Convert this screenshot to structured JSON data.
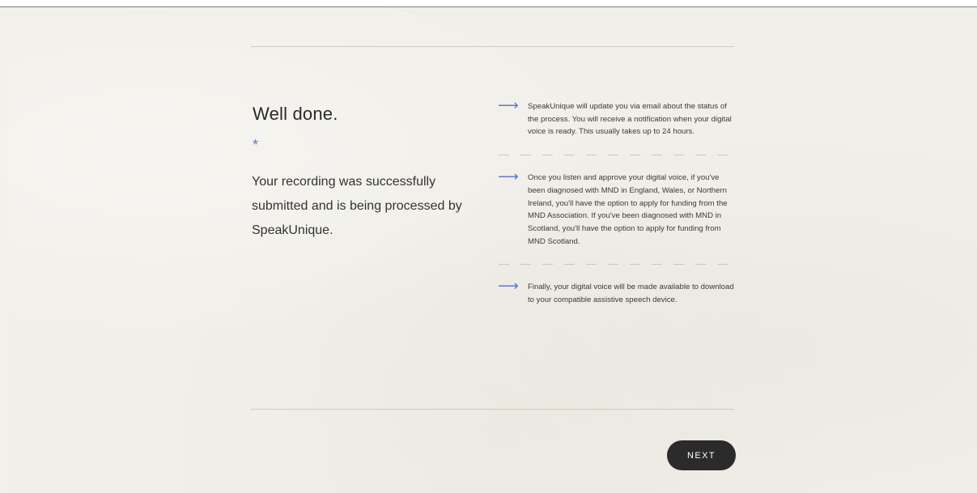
{
  "heading": {
    "title": "Well done.",
    "asterisk": "*"
  },
  "message": "Your recording was successfully submitted and is being processed by SpeakUnique.",
  "steps": [
    {
      "arrow": "⟶",
      "text": "SpeakUnique will update you via email about the status of the process. You will receive a notification when your digital voice is ready. This usually takes up to 24 hours."
    },
    {
      "arrow": "⟶",
      "text": "Once you listen and approve your digital voice, if you've been diagnosed with MND in England, Wales, or Northern Ireland, you'll have the option to apply for funding from the MND Association. If you've been diagnosed with MND in Scotland, you'll have the option to apply for funding from MND Scotland."
    },
    {
      "arrow": "⟶",
      "text": "Finally, your digital voice will be made available to download to your compatible assistive speech device."
    }
  ],
  "next_button": {
    "label": "NEXT"
  },
  "colors": {
    "accent": "#5d79d6",
    "button_bg": "#2b2b2b",
    "background": "#f1efe9"
  }
}
